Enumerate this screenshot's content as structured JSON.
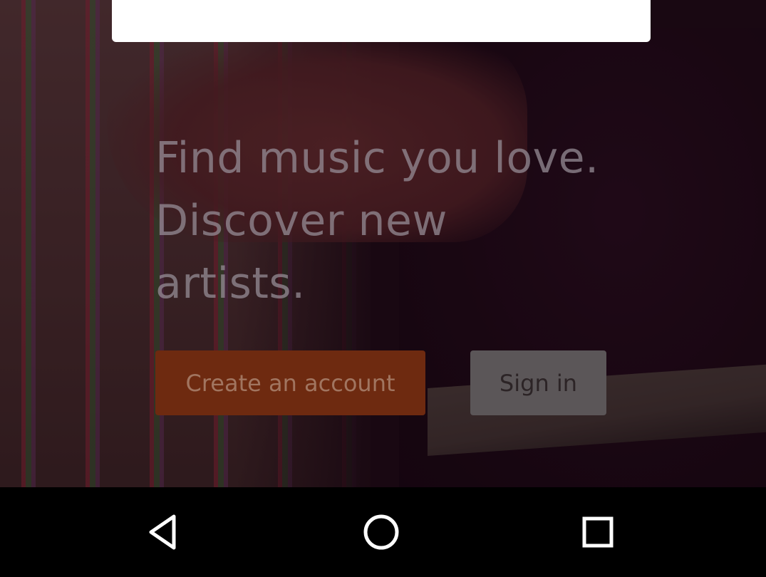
{
  "tagline": {
    "line1": "Find music you love.",
    "line2": "Discover new",
    "line3": "artists."
  },
  "buttons": {
    "create_account": "Create an account",
    "sign_in": "Sign in"
  },
  "colors": {
    "create_button_bg": "#6e2a10",
    "sign_in_button_bg": "#5b5658",
    "nav_bar_bg": "#000000"
  },
  "icons": {
    "back": "back-triangle-icon",
    "home": "home-circle-icon",
    "recents": "recents-square-icon"
  }
}
